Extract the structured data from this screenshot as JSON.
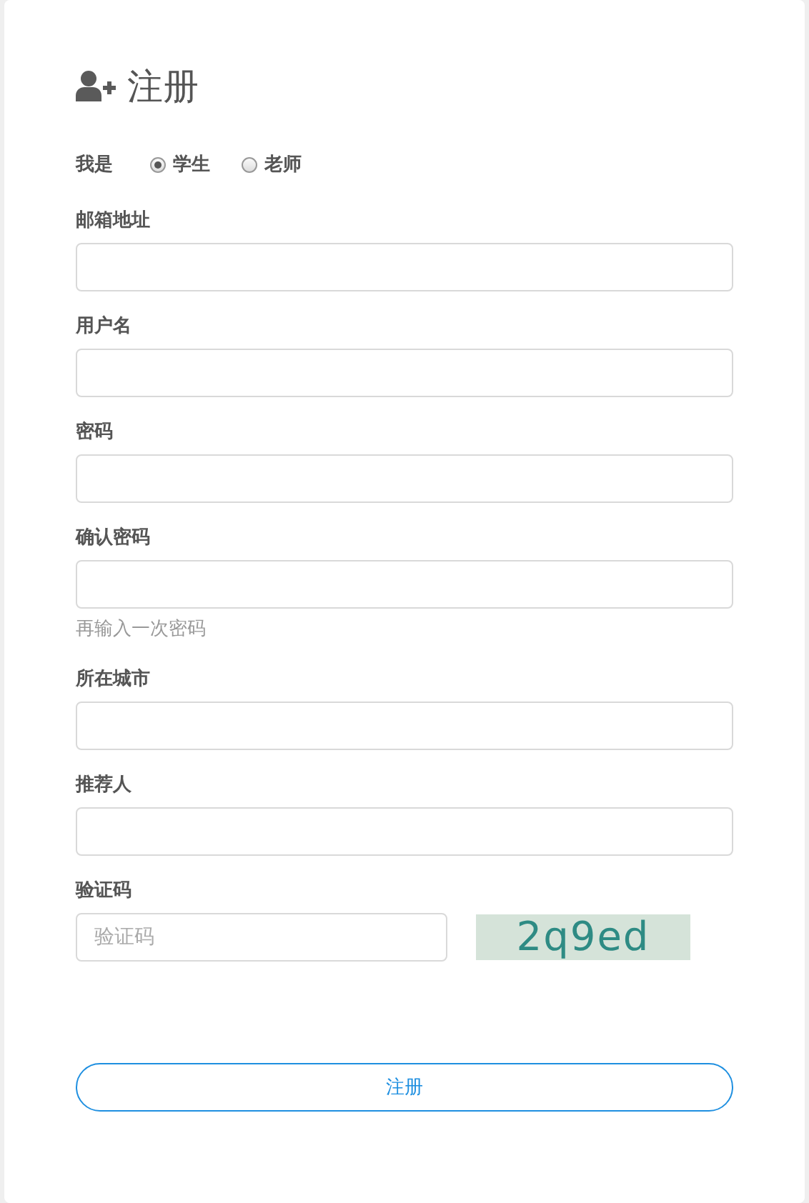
{
  "title": "注册",
  "role": {
    "label": "我是",
    "options": [
      {
        "label": "学生",
        "selected": true
      },
      {
        "label": "老师",
        "selected": false
      }
    ]
  },
  "fields": [
    {
      "label": "邮箱地址"
    },
    {
      "label": "用户名"
    },
    {
      "label": "密码"
    },
    {
      "label": "确认密码",
      "hint": "再输入一次密码"
    },
    {
      "label": "所在城市"
    },
    {
      "label": "推荐人"
    },
    {
      "label": "验证码",
      "placeholder": "验证码",
      "captcha": "2q9ed"
    }
  ],
  "submit": "注册"
}
